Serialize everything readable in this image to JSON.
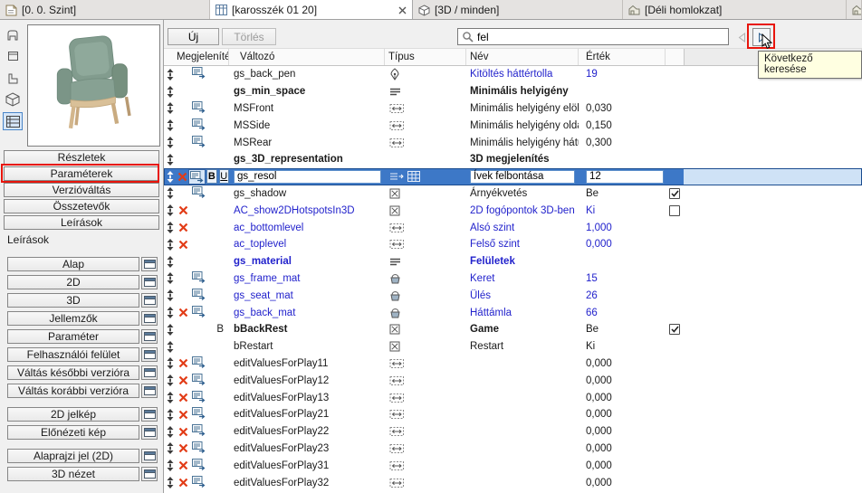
{
  "colors": {
    "param_blue": "#2222cc",
    "selection_blue": "#3d78c7",
    "annotation_red": "#e8150c",
    "tooltip_bg": "#ffffe1"
  },
  "tabbar": {
    "tabs": [
      {
        "label": "[0. 0. Szint]",
        "icon": "floorplan-tab-icon",
        "active": false,
        "closable": false
      },
      {
        "label": "[karosszék 01 20]",
        "icon": "object-tab-icon",
        "active": true,
        "closable": true
      },
      {
        "label": "[3D / minden]",
        "icon": "3d-tab-icon",
        "active": false,
        "closable": false
      },
      {
        "label": "[Déli homlokzat]",
        "icon": "elevation-tab-icon",
        "active": false,
        "closable": false
      }
    ],
    "partial_tab_icon": "elevation-tab-icon"
  },
  "sidebar": {
    "preview_tools": [
      {
        "icon": "preview-front-view-icon",
        "selected": false
      },
      {
        "icon": "preview-top-view-icon",
        "selected": false
      },
      {
        "icon": "preview-side-view-icon",
        "selected": false
      },
      {
        "icon": "preview-3d-view-icon",
        "selected": false
      },
      {
        "icon": "preview-list-icon",
        "selected": true
      }
    ],
    "main_buttons": [
      {
        "label": "Részletek",
        "annotated": false
      },
      {
        "label": "Paraméterek",
        "annotated": true
      },
      {
        "label": "Verzióváltás",
        "annotated": false
      },
      {
        "label": "Összetevők",
        "annotated": false
      },
      {
        "label": "Leírások",
        "annotated": false
      }
    ],
    "section_label": "Leírások",
    "script_buttons": [
      {
        "label": "Alap",
        "group": 1
      },
      {
        "label": "2D",
        "group": 1
      },
      {
        "label": "3D",
        "group": 1
      },
      {
        "label": "Jellemzők",
        "group": 1
      },
      {
        "label": "Paraméter",
        "group": 1
      },
      {
        "label": "Felhasználói felület",
        "group": 1
      },
      {
        "label": "Váltás későbbi verzióra",
        "group": 1
      },
      {
        "label": "Váltás korábbi verzióra",
        "group": 1
      },
      {
        "label": "2D jelkép",
        "group": 2
      },
      {
        "label": "Előnézeti kép",
        "group": 2
      },
      {
        "label": "Alaprajzi jel (2D)",
        "group": 3
      },
      {
        "label": "3D nézet",
        "group": 3
      }
    ]
  },
  "toolbar": {
    "new_label": "Új",
    "delete_label": "Törlés",
    "search_icon": "search-icon",
    "search_value": "fel",
    "prev_icon": "previous-search-icon",
    "next_icon": "next-search-icon",
    "tooltip": "Következő keresése"
  },
  "table": {
    "columns": [
      "Megjelenítés",
      "Változó",
      "Típus",
      "Név",
      "Érték"
    ],
    "rows": [
      {
        "variable": {
          "text": "gs_back_pen"
        },
        "display_toggle": true,
        "type_icons": [
          "pen-type-icon"
        ],
        "name": {
          "text": "Kitöltés háttértolla",
          "color": "blue"
        },
        "value": {
          "text": "19",
          "color": "blue"
        }
      },
      {
        "variable": {
          "text": "gs_min_space",
          "bold": true
        },
        "type_icons": [
          "title-type-icon"
        ],
        "name": {
          "text": "Minimális helyigény",
          "bold": true
        }
      },
      {
        "variable": {
          "text": "MSFront"
        },
        "display_toggle": true,
        "type_icons": [
          "length-type-icon"
        ],
        "name": {
          "text": "Minimális helyigény elöl"
        },
        "value": {
          "text": "0,030"
        }
      },
      {
        "variable": {
          "text": "MSSide"
        },
        "display_toggle": true,
        "type_icons": [
          "length-type-icon"
        ],
        "name": {
          "text": "Minimális helyigény oldalt"
        },
        "value": {
          "text": "0,150"
        }
      },
      {
        "variable": {
          "text": "MSRear"
        },
        "display_toggle": true,
        "type_icons": [
          "length-type-icon"
        ],
        "name": {
          "text": "Minimális helyigény hátul"
        },
        "value": {
          "text": "0,300"
        }
      },
      {
        "variable": {
          "text": "gs_3D_representation",
          "bold": true
        },
        "type_icons": [],
        "name": {
          "text": "3D megjelenítés",
          "bold": true
        }
      },
      {
        "selected": true,
        "delete_x": true,
        "display_toggle": true,
        "style_buttons": [
          "B",
          "U"
        ],
        "variable": {
          "text": "gs_resol"
        },
        "type_icons": [
          "value-list-icon",
          "array-values-icon"
        ],
        "name": {
          "text": "Ívek felbontása"
        },
        "value": {
          "text": "12"
        }
      },
      {
        "variable": {
          "text": "gs_shadow"
        },
        "display_toggle": true,
        "type_icons": [
          "bool-type-icon"
        ],
        "name": {
          "text": "Árnyékvetés"
        },
        "value": {
          "text": "Be"
        },
        "checkbox": "checked"
      },
      {
        "delete_x": true,
        "variable": {
          "text": "AC_show2DHotspotsIn3D",
          "color": "blue"
        },
        "type_icons": [
          "bool-type-icon"
        ],
        "name": {
          "text": "2D fogópontok 3D-ben",
          "color": "blue"
        },
        "value": {
          "text": "Ki",
          "color": "blue"
        },
        "checkbox": "unchecked"
      },
      {
        "delete_x": true,
        "variable": {
          "text": "ac_bottomlevel",
          "color": "blue"
        },
        "type_icons": [
          "length-type-icon"
        ],
        "name": {
          "text": "Alsó szint",
          "color": "blue"
        },
        "value": {
          "text": "1,000",
          "color": "blue"
        }
      },
      {
        "delete_x": true,
        "variable": {
          "text": "ac_toplevel",
          "color": "blue"
        },
        "type_icons": [
          "length-type-icon"
        ],
        "name": {
          "text": "Felső szint",
          "color": "blue"
        },
        "value": {
          "text": "0,000",
          "color": "blue"
        }
      },
      {
        "variable": {
          "text": "gs_material",
          "color": "blue",
          "bold": true
        },
        "type_icons": [
          "title-type-icon"
        ],
        "name": {
          "text": "Felületek",
          "color": "blue",
          "bold": true
        }
      },
      {
        "variable": {
          "text": "gs_frame_mat",
          "color": "blue"
        },
        "display_toggle": true,
        "type_icons": [
          "material-type-icon"
        ],
        "name": {
          "text": "Keret",
          "color": "blue"
        },
        "value": {
          "text": "15",
          "color": "blue"
        }
      },
      {
        "variable": {
          "text": "gs_seat_mat",
          "color": "blue"
        },
        "display_toggle": true,
        "type_icons": [
          "material-type-icon"
        ],
        "name": {
          "text": "Ülés",
          "color": "blue"
        },
        "value": {
          "text": "26",
          "color": "blue"
        }
      },
      {
        "delete_x": true,
        "display_toggle": true,
        "variable": {
          "text": "gs_back_mat",
          "color": "blue"
        },
        "type_icons": [
          "material-type-icon"
        ],
        "name": {
          "text": "Háttámla",
          "color": "blue"
        },
        "value": {
          "text": "66",
          "color": "blue"
        }
      },
      {
        "bold_flag": "B",
        "variable": {
          "text": "bBackRest",
          "bold": true
        },
        "type_icons": [
          "bool-type-icon"
        ],
        "name": {
          "text": "Game",
          "bold": true
        },
        "value": {
          "text": "Be"
        },
        "checkbox": "checked"
      },
      {
        "variable": {
          "text": "bRestart"
        },
        "type_icons": [
          "bool-type-icon"
        ],
        "name": {
          "text": "Restart"
        },
        "value": {
          "text": "Ki"
        }
      },
      {
        "delete_x": true,
        "display_toggle": true,
        "variable": {
          "text": "editValuesForPlay11"
        },
        "type_icons": [
          "length-type-icon"
        ],
        "value": {
          "text": "0,000"
        }
      },
      {
        "delete_x": true,
        "display_toggle": true,
        "variable": {
          "text": "editValuesForPlay12"
        },
        "type_icons": [
          "length-type-icon"
        ],
        "value": {
          "text": "0,000"
        }
      },
      {
        "delete_x": true,
        "display_toggle": true,
        "variable": {
          "text": "editValuesForPlay13"
        },
        "type_icons": [
          "length-type-icon"
        ],
        "value": {
          "text": "0,000"
        }
      },
      {
        "delete_x": true,
        "display_toggle": true,
        "variable": {
          "text": "editValuesForPlay21"
        },
        "type_icons": [
          "length-type-icon"
        ],
        "value": {
          "text": "0,000"
        }
      },
      {
        "delete_x": true,
        "display_toggle": true,
        "variable": {
          "text": "editValuesForPlay22"
        },
        "type_icons": [
          "length-type-icon"
        ],
        "value": {
          "text": "0,000"
        }
      },
      {
        "delete_x": true,
        "display_toggle": true,
        "variable": {
          "text": "editValuesForPlay23"
        },
        "type_icons": [
          "length-type-icon"
        ],
        "value": {
          "text": "0,000"
        }
      },
      {
        "delete_x": true,
        "display_toggle": true,
        "variable": {
          "text": "editValuesForPlay31"
        },
        "type_icons": [
          "length-type-icon"
        ],
        "value": {
          "text": "0,000"
        }
      },
      {
        "delete_x": true,
        "display_toggle": true,
        "variable": {
          "text": "editValuesForPlay32"
        },
        "type_icons": [
          "length-type-icon"
        ],
        "value": {
          "text": "0,000"
        }
      }
    ]
  }
}
